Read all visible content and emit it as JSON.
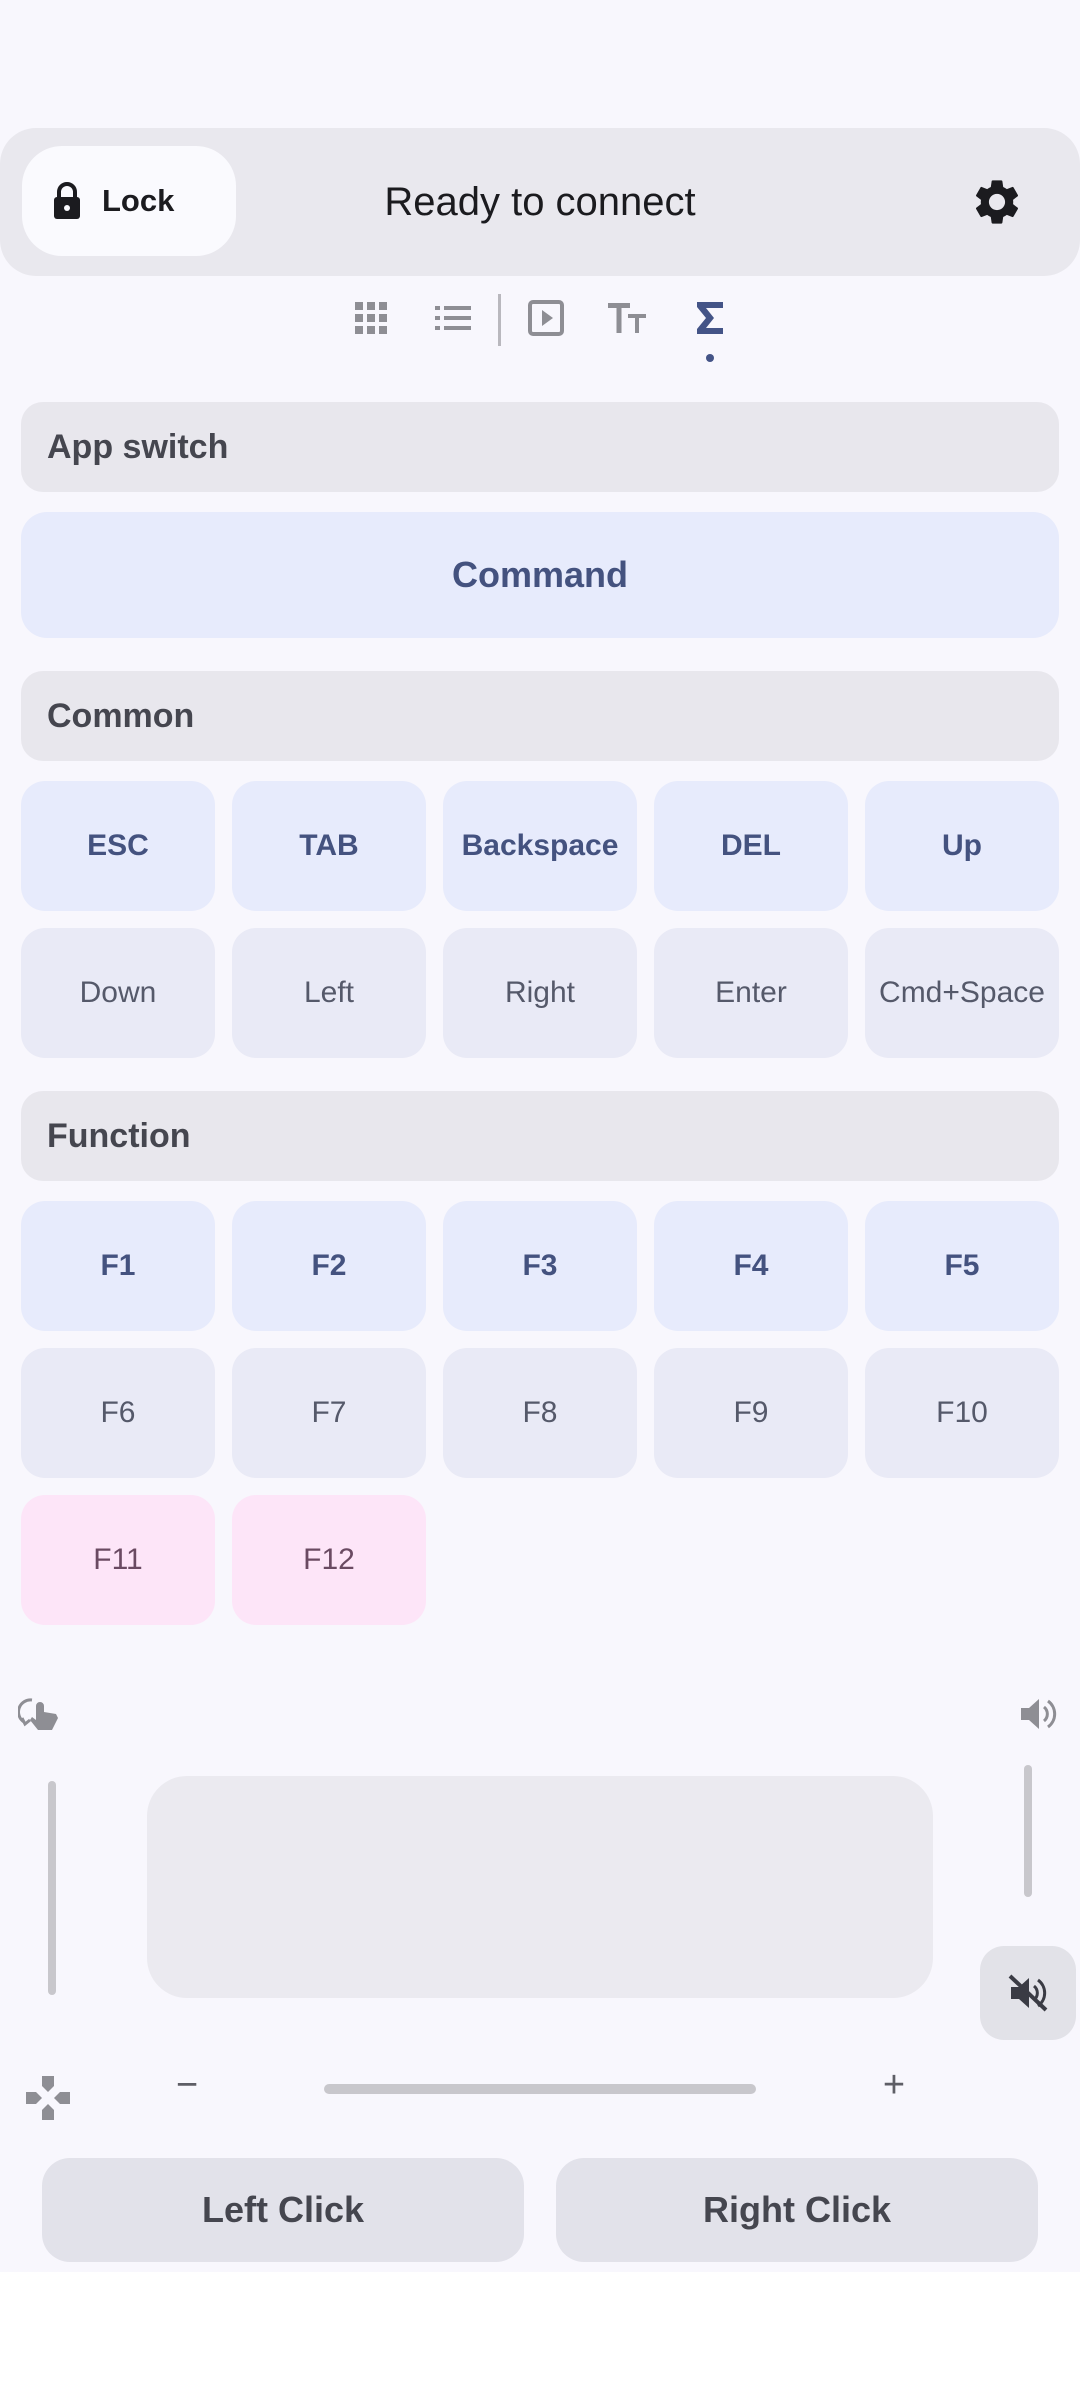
{
  "header": {
    "lock_label": "Lock",
    "status_text": "Ready to connect"
  },
  "tabs": [
    {
      "icon": "grid-icon",
      "active": false
    },
    {
      "icon": "list-icon",
      "active": false
    },
    {
      "icon": "play-box-icon",
      "active": false
    },
    {
      "icon": "text-size-icon",
      "active": false
    },
    {
      "icon": "sigma-icon",
      "active": true
    }
  ],
  "sections": {
    "app_switch": {
      "title": "App switch",
      "keys": [
        "Command"
      ]
    },
    "common": {
      "title": "Common",
      "keys": [
        "ESC",
        "TAB",
        "Backspace",
        "DEL",
        "Up",
        "Down",
        "Left",
        "Right",
        "Enter",
        "Cmd+Space"
      ]
    },
    "function": {
      "title": "Function",
      "keys": [
        "F1",
        "F2",
        "F3",
        "F4",
        "F5",
        "F6",
        "F7",
        "F8",
        "F9",
        "F10",
        "F11",
        "F12"
      ]
    }
  },
  "bottom": {
    "minus": "−",
    "plus": "+",
    "left_click": "Left Click",
    "right_click": "Right Click"
  },
  "colors": {
    "accent": "#445487",
    "key_primary_bg": "#e7ebfc",
    "key_secondary_bg": "#e9eaf6",
    "key_tertiary_bg": "#fde5f8"
  }
}
